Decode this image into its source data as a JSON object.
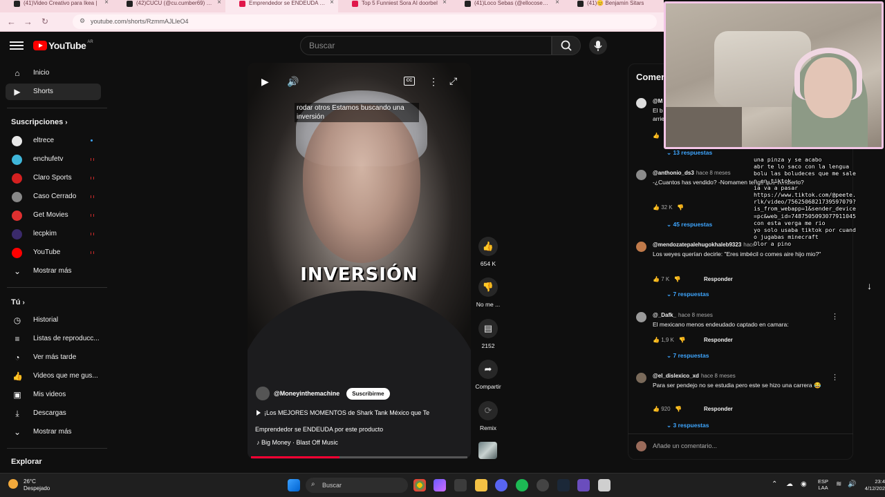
{
  "browser": {
    "tabs": [
      {
        "label": "(41)Video Creativo para Ikea | "
      },
      {
        "label": "(42)CUCU (@cu.cumber69) | Ti"
      },
      {
        "label": "Emprendedor se ENDEUDA por",
        "active": true
      },
      {
        "label": "Top 5 Funniest Sora AI doorbel"
      },
      {
        "label": "(41)Loco Sebas (@ellocosebas"
      },
      {
        "label": "(41)😊 Benjamin Sitars"
      }
    ],
    "url": "youtube.com/shorts/RzmmAJLleO4"
  },
  "header": {
    "logo_text": "YouTube",
    "country": "AR",
    "search_placeholder": "Buscar"
  },
  "sidebar": {
    "main": [
      {
        "label": "Inicio",
        "icon": "home-icon"
      },
      {
        "label": "Shorts",
        "icon": "shorts-icon",
        "active": true
      }
    ],
    "subs_heading": "Suscripciones",
    "subscriptions": [
      {
        "label": "eltrece",
        "color": "#e8e8e8",
        "status": "new"
      },
      {
        "label": "enchufetv",
        "color": "#3fb6d9",
        "status": "live"
      },
      {
        "label": "Claro Sports",
        "color": "#d42020",
        "status": "live"
      },
      {
        "label": "Caso Cerrado",
        "color": "#888888",
        "status": "live"
      },
      {
        "label": "Get Movies",
        "color": "#e03030",
        "status": "live"
      },
      {
        "label": "lecpkim",
        "color": "#3a2a6a",
        "status": "live"
      },
      {
        "label": "YouTube",
        "color": "#ff0000",
        "status": "live"
      }
    ],
    "subs_more": "Mostrar más",
    "you_heading": "Tú",
    "you": [
      {
        "label": "Historial",
        "icon": "history-icon"
      },
      {
        "label": "Listas de reproducc...",
        "icon": "playlists-icon"
      },
      {
        "label": "Ver más tarde",
        "icon": "watch-later-icon"
      },
      {
        "label": "Videos que me gus...",
        "icon": "liked-icon"
      },
      {
        "label": "Mis videos",
        "icon": "my-videos-icon"
      },
      {
        "label": "Descargas",
        "icon": "downloads-icon"
      }
    ],
    "you_more": "Mostrar más",
    "explore_heading": "Explorar"
  },
  "video": {
    "caption": "rodar otros Estamos buscando una inversión",
    "overlay_text": "INVERSIÓN",
    "channel": "@Moneyinthemachine",
    "subscribe": "Suscribirme",
    "title_line1": "¡Los MEJORES MOMENTOS de Shark Tank México que Te",
    "title_line2": "Emprendedor se ENDEUDA por este producto",
    "music": "Big Money · Blast Off Music",
    "progress_fraction": 0.41
  },
  "actions": {
    "likes": "654 K",
    "dislike": "No me ...",
    "comments": "2152",
    "share": "Compartir",
    "remix": "Remix"
  },
  "comments": {
    "title": "Comen",
    "input_placeholder": "Añade un comentario...",
    "items": [
      {
        "author": "@M",
        "time": "",
        "text": "El b arrie",
        "likes": "",
        "replies": "13 respuestas"
      },
      {
        "author": "@anthonio_ds3",
        "time": "hace 8 meses",
        "text": "-¿Cuantos has vendido? -Nomamen tengo que vendierlo?",
        "likes": "32 K",
        "replies": "45 respuestas"
      },
      {
        "author": "@mendozatepalehugokhaleb9323",
        "time": "hace",
        "text": "Los weyes querían decirle: \"Eres imbécil o comes aire hijo mio?\"",
        "likes": "7 K",
        "reply": "Responder",
        "replies": "7 respuestas"
      },
      {
        "author": "@_Dafk_",
        "time": "hace 8 meses",
        "text": "El mexicano menos endeudado captado en camara:",
        "likes": "1,9 K",
        "reply": "Responder",
        "replies": "7 respuestas"
      },
      {
        "author": "@el_dislexico_xd",
        "time": "hace 8 meses",
        "text": "Para ser pendejo no se estudia pero este se hizo una carrera 😂",
        "likes": "920",
        "reply": "Responder",
        "replies": "3 respuestas"
      }
    ]
  },
  "stream_chat": [
    "una pinza y se acabo",
    "abr te lo saco con la lengua",
    "bolu las boludeces que me salen en tiktok",
    "ia va a pasar",
    "https://www.tiktok.com/@peete.rlk/video/7562506821739597079?is_from_webapp=1&sender_device=pc&web_id=7487505093077911045 con esta verga me rio",
    "yo solo usaba tiktok por cuando jugabas minecraft",
    "Olor a pino"
  ],
  "taskbar": {
    "temp": "26°C",
    "weather": "Despejado",
    "search_placeholder": "Buscar",
    "lang1": "ESP",
    "lang2": "LAA",
    "time": "23:4",
    "date": "4/12/202"
  }
}
